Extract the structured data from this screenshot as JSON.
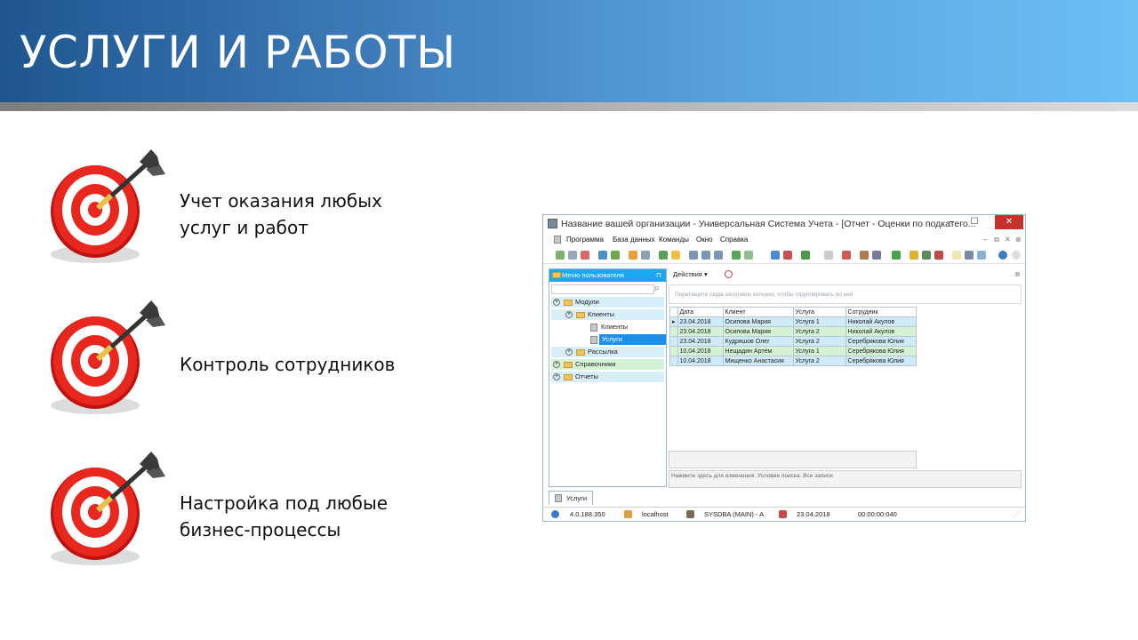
{
  "slide": {
    "title": "УСЛУГИ И РАБОТЫ",
    "bullets": [
      {
        "text": "Учет оказания любых\nуслуг и работ",
        "icon": "target-dart-icon"
      },
      {
        "text": "Контроль сотрудников",
        "icon": "target-dart-icon"
      },
      {
        "text": "Настройка под любые\nбизнес-процессы",
        "icon": "target-dart-icon"
      }
    ]
  },
  "app": {
    "window_title": "Название вашей организации - Универсальная Система Учета - [Отчет - Оценки по подкатего...",
    "menu": [
      "Программа",
      "База данных",
      "Команды",
      "Окно",
      "Справка"
    ],
    "left_panel_title": "Меню пользователя",
    "tree": {
      "modules": "Модули",
      "clients_folder": "Клиенты",
      "clients_item": "Клиенты",
      "services_item": "Услуги",
      "mailing": "Рассылка",
      "references": "Справочники",
      "reports": "Отчеты"
    },
    "actions_label": "Действия",
    "group_hint": "Перетащите сюда заголовок колонки, чтобы сгруппировать по ней",
    "columns": [
      "Дата",
      "Клиент",
      "Услуга",
      "Сотрудник"
    ],
    "rows": [
      [
        "23.04.2018",
        "Осипова Мария",
        "Услуга 1",
        "Николай Акулов"
      ],
      [
        "23.04.2018",
        "Осипова Мария",
        "Услуга 2",
        "Николай Акулов"
      ],
      [
        "23.04.2018",
        "Кудряшов Олег",
        "Услуга 2",
        "Серебрякова Юлия"
      ],
      [
        "10.04.2018",
        "Нещадин Артем",
        "Услуга 1",
        "Серебрякова Юлия"
      ],
      [
        "10.04.2018",
        "Мищенко Анастасия",
        "Услуга 2",
        "Серебрякова Юлия"
      ]
    ],
    "filter_hint": "Нажмите здесь для изменения. Условие поиска: Все записи",
    "tab_label": "Услуги",
    "status": {
      "version": "4.0.188.350",
      "server": "localhost",
      "user": "SYSDBA (MAIN) - A",
      "date": "23.04.2018",
      "time": "00:00:00:040"
    }
  }
}
